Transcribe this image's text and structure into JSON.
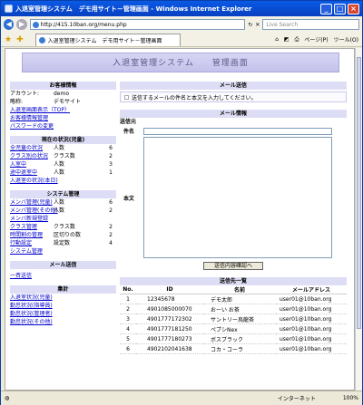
{
  "window": {
    "title": "入退室管理システム　デモ用サイト－管理画面 - Windows Internet Explorer"
  },
  "browser": {
    "url": "http://415.10ban.org/menu.php",
    "search_placeholder": "Live Search",
    "tab_label": "入退室管理システム　デモ用サイト－管理画面",
    "page_menu": "ページ(P)",
    "tools_menu": "ツール(O)"
  },
  "status": {
    "zone": "インターネット",
    "zoom": "100%"
  },
  "page": {
    "banner": "入退室管理システム　　管理画面",
    "customer": {
      "header": "お客様情報",
      "account_label": "アカウント:",
      "account_value": "demo",
      "name_label": "略称:",
      "name_value": "デモサイト",
      "links": [
        "入退室画面表示（TOP）",
        "お客様情報管理",
        "パスワードの変更"
      ]
    },
    "current": {
      "header": "現在の状況(児童)",
      "rows": [
        {
          "label": "全児童の状況",
          "unit": "人数",
          "count": "6"
        },
        {
          "label": "クラス別の状況",
          "unit": "クラス数",
          "count": "2"
        },
        {
          "label": "入室中",
          "unit": "人数",
          "count": "3"
        },
        {
          "label": "途中退室中",
          "unit": "人数",
          "count": "1"
        }
      ],
      "link": "入退室の状況(本日)"
    },
    "system": {
      "header": "システム管理",
      "rows": [
        {
          "label": "メンバ管理(児童)",
          "unit": "人数",
          "count": "6"
        },
        {
          "label": "メンバ管理(その他)",
          "unit": "人数",
          "count": "2"
        },
        {
          "label": "メンバ新規登録",
          "unit": "",
          "count": ""
        },
        {
          "label": "クラス管理",
          "unit": "クラス数",
          "count": "2"
        },
        {
          "label": "時間割の管理",
          "unit": "区切りの数",
          "count": "2"
        },
        {
          "label": "行動設定",
          "unit": "設定数",
          "count": "4"
        },
        {
          "label": "システム管理",
          "unit": "",
          "count": ""
        }
      ]
    },
    "mail": {
      "header": "メール送信",
      "link": "一斉送信"
    },
    "stats": {
      "header": "集計",
      "links": [
        "入退室状況(児童)",
        "勤怠状況(指導員)",
        "勤怠状況(管理者)",
        "勤怠状況(その他)"
      ]
    },
    "send": {
      "header": "メール送信",
      "notice": "送信するメールの件名と本文を入力してください。"
    },
    "mailinfo": {
      "header": "メール情報",
      "from_label": "送信元",
      "subject_label": "件名",
      "body_label": "本文",
      "button": "送信内容確認へ"
    },
    "recipients": {
      "header": "送信先一覧",
      "columns": [
        "No.",
        "ID",
        "名前",
        "メールアドレス"
      ],
      "rows": [
        [
          "1",
          "12345678",
          "デモ太郎",
          "user01@10ban.org"
        ],
        [
          "2",
          "4901085000070",
          "おーい お茶",
          "user01@10ban.org"
        ],
        [
          "3",
          "4901777172302",
          "サントリー烏龍茶",
          "user01@10ban.org"
        ],
        [
          "4",
          "4901777181250",
          "ペプシNex",
          "user01@10ban.org"
        ],
        [
          "5",
          "4901777180273",
          "ボスブラック",
          "user01@10ban.org"
        ],
        [
          "6",
          "4902102041638",
          "コカ・コーラ",
          "user01@10ban.org"
        ]
      ]
    }
  }
}
